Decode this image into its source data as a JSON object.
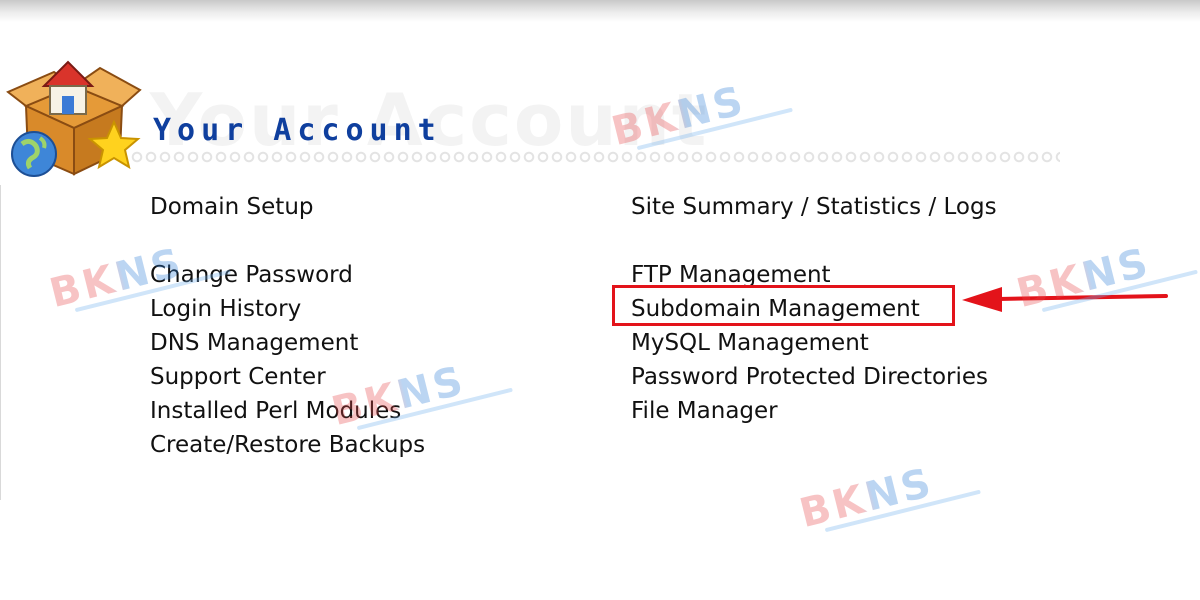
{
  "header": {
    "title": "Your Account",
    "ghost_title": "Your Account",
    "logo_icon": "house-box-globe-star-icon"
  },
  "menu": {
    "left": [
      {
        "label": "Domain Setup",
        "name": "menu-domain-setup"
      },
      {
        "label": "Change Password",
        "name": "menu-change-password"
      },
      {
        "label": "Login History",
        "name": "menu-login-history"
      },
      {
        "label": "DNS Management",
        "name": "menu-dns-management"
      },
      {
        "label": "Support Center",
        "name": "menu-support-center"
      },
      {
        "label": "Installed Perl Modules",
        "name": "menu-installed-perl-modules"
      },
      {
        "label": "Create/Restore Backups",
        "name": "menu-create-restore-backups"
      }
    ],
    "right": [
      {
        "label": "Site Summary / Statistics / Logs",
        "name": "menu-site-summary"
      },
      {
        "label": "FTP Management",
        "name": "menu-ftp-management"
      },
      {
        "label": "Subdomain Management",
        "name": "menu-subdomain-management"
      },
      {
        "label": "MySQL Management",
        "name": "menu-mysql-management"
      },
      {
        "label": "Password Protected Directories",
        "name": "menu-password-protected-directories"
      },
      {
        "label": "File Manager",
        "name": "menu-file-manager"
      }
    ]
  },
  "annotation": {
    "highlighted_item": "Subdomain Management",
    "highlight_color": "#e3131a",
    "arrow_icon": "left-arrow-icon"
  },
  "watermark": {
    "text": "BKNS",
    "colors": [
      "#e8474a",
      "#2f7ed8"
    ]
  }
}
